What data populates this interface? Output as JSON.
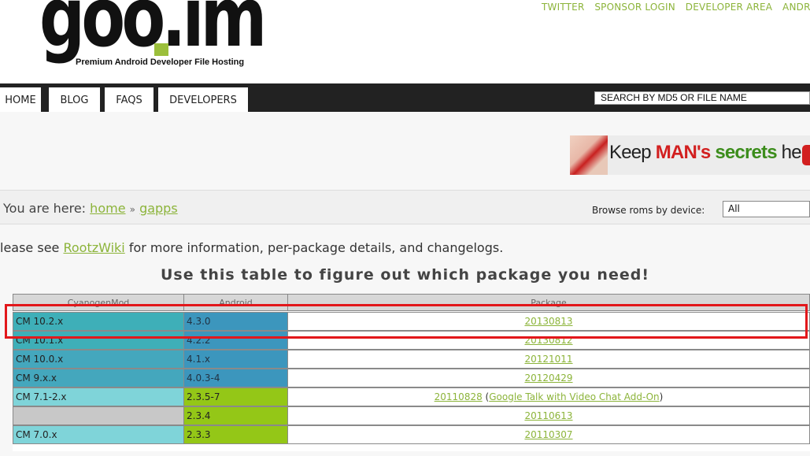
{
  "header": {
    "logo_text": "goo.im",
    "tagline": "Premium Android Developer File Hosting",
    "top_links": [
      "TWITTER",
      "SPONSOR LOGIN",
      "DEVELOPER AREA",
      "ANDROID A"
    ]
  },
  "nav": {
    "tabs": [
      "HOME",
      "BLOG",
      "FAQS",
      "DEVELOPERS"
    ],
    "search_placeholder": "SEARCH BY MD5 OR FILE NAME"
  },
  "ad": {
    "part1": "Keep ",
    "part2": "MAN's",
    "part3": " ",
    "part4": "secrets",
    "part5": " here."
  },
  "breadcrumb": {
    "prefix": "You are here:",
    "home": "home",
    "separator": "»",
    "current": "gapps"
  },
  "browse": {
    "label": "Browse roms by device:",
    "selected": "All"
  },
  "info": {
    "before": "lease see ",
    "link": "RootzWiki",
    "after": " for more information, per-package details, and changelogs."
  },
  "table": {
    "title": "Use this table to figure out which package you need!",
    "headers": [
      "CyanogenMod",
      "Android",
      "Package"
    ],
    "rows": [
      {
        "cm": "CM 10.2.x",
        "android": "4.3.0",
        "package": "20130813",
        "extra": ""
      },
      {
        "cm": "CM 10.1.x",
        "android": "4.2.2",
        "package": "20130812",
        "extra": ""
      },
      {
        "cm": "CM 10.0.x",
        "android": "4.1.x",
        "package": "20121011",
        "extra": ""
      },
      {
        "cm": "CM 9.x.x",
        "android": "4.0.3-4",
        "package": "20120429",
        "extra": ""
      },
      {
        "cm": "CM 7.1-2.x",
        "android": "2.3.5-7",
        "package": "20110828",
        "extra": "Google Talk with Video Chat Add-On"
      },
      {
        "cm": "",
        "android": "2.3.4",
        "package": "20110613",
        "extra": ""
      },
      {
        "cm": "CM 7.0.x",
        "android": "2.3.3",
        "package": "20110307",
        "extra": ""
      }
    ]
  },
  "colors": {
    "accent": "#8cb43a",
    "nav_bg": "#222222",
    "highlight": "#e2171b"
  }
}
